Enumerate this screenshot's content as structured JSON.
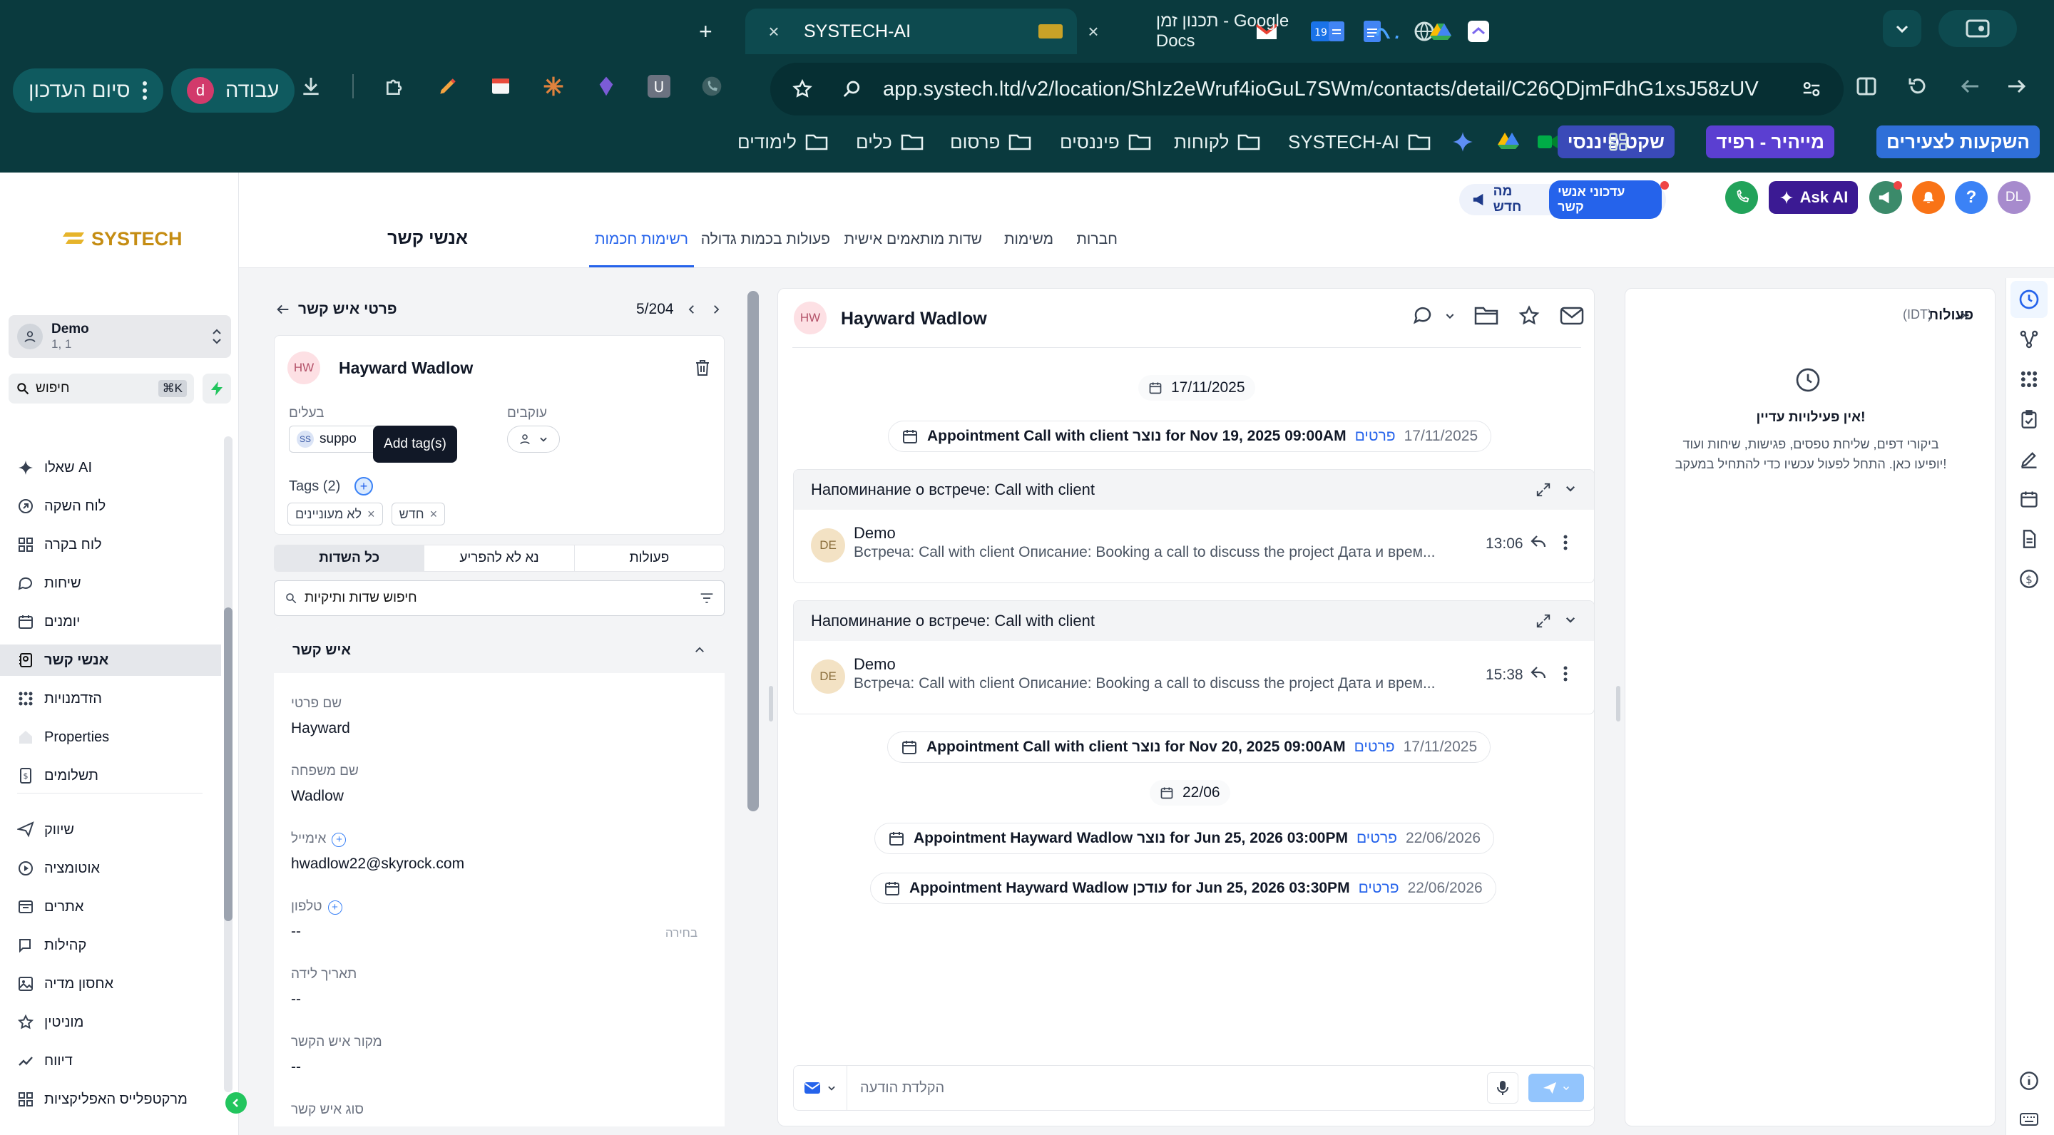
{
  "browser": {
    "tabs": [
      {
        "title": "SYSTECH-AI",
        "active": true
      },
      {
        "title": "תכנון זמן - Google Docs",
        "active": false
      }
    ],
    "url": "app.systech.ltd/v2/location/ShIz2eWruf4ioGuL7SWm/contacts/detail/C26QDjmFdhG1xsJ58zUV",
    "profile_pill": {
      "label": "עבודה",
      "avatar": "d"
    },
    "update_pill": "סיום העדכון",
    "bookmarks": [
      "SYSTECH-AI",
      "לקוחות",
      "פיננסים",
      "פרסום",
      "כלים",
      "לימודים"
    ],
    "bookmark_chips": [
      {
        "label": "השקעות לצעירים",
        "color": "#2f6fd8"
      },
      {
        "label": "מייהיר - רפיד",
        "color": "#5b3fd1"
      },
      {
        "label": "שקט פיננסי",
        "color": "#3a4ab8"
      }
    ]
  },
  "sidebar": {
    "logo": "SYSTECH",
    "account": {
      "name": "Demo",
      "sub": "1, 1"
    },
    "search": {
      "placeholder": "חיפוש",
      "shortcut": "⌘K"
    },
    "items": [
      {
        "label": "שאלו AI",
        "icon": "sparkle-icon"
      },
      {
        "label": "לוח השקה",
        "icon": "launch-icon"
      },
      {
        "label": "לוח בקרה",
        "icon": "dashboard-icon"
      },
      {
        "label": "שיחות",
        "icon": "chat-icon"
      },
      {
        "label": "יומנים",
        "icon": "calendar-icon"
      },
      {
        "label": "אנשי קשר",
        "icon": "contacts-icon",
        "active": true
      },
      {
        "label": "הזדמנויות",
        "icon": "opportunities-icon"
      },
      {
        "label": "Properties",
        "icon": "home-icon"
      },
      {
        "label": "תשלומים",
        "icon": "payments-icon"
      },
      {
        "label": "שיווק",
        "icon": "send-icon"
      },
      {
        "label": "אוטומציה",
        "icon": "automation-icon"
      },
      {
        "label": "אתרים",
        "icon": "sites-icon"
      },
      {
        "label": "קהילות",
        "icon": "communities-icon"
      },
      {
        "label": "אחסון מדיה",
        "icon": "media-icon"
      },
      {
        "label": "מוניטין",
        "icon": "star-icon"
      },
      {
        "label": "דיווח",
        "icon": "report-icon"
      },
      {
        "label": "מרקטפלייס האפליקציות",
        "icon": "marketplace-icon"
      }
    ]
  },
  "topbar": {
    "tabs": [
      "אנשי קשר",
      "רשימות חכמות",
      "פעולות בכמות גדולה",
      "שדות מותאמים אישית",
      "משימות",
      "חברות"
    ],
    "active_tab": "רשימות חכמות",
    "whats_new": "מה חדש",
    "contacts_update": "עדכוני אנשי קשר",
    "ask_ai": "Ask AI",
    "user_initials": "DL"
  },
  "contact_panel": {
    "title": "פרטי איש קשר",
    "pager": "5/204",
    "initials": "HW",
    "name": "Hayward Wadlow",
    "owner_label": "בעלים",
    "owner_value": "suppo",
    "owner_initials": "SS",
    "followers_label": "עוקבים",
    "tags_label": "Tags (2)",
    "tooltip": "Add tag(s)",
    "tags": [
      "לא מעוניינים",
      "חדש"
    ],
    "subtabs": [
      "כל השדות",
      "נא לא להפריע",
      "פעולות"
    ],
    "active_subtab": "כל השדות",
    "field_search_placeholder": "חיפוש שדות ותיקיות",
    "section_title": "איש קשר",
    "fields": [
      {
        "label": "שם פרטי",
        "value": "Hayward"
      },
      {
        "label": "שם משפחה",
        "value": "Wadlow"
      },
      {
        "label": "אימייל",
        "value": "hwadlow22@skyrock.com"
      },
      {
        "label": "טלפון",
        "value": "--",
        "hint": "בחירה"
      },
      {
        "label": "תאריך לידה",
        "value": "--"
      },
      {
        "label": "מקור איש הקשר",
        "value": "--"
      },
      {
        "label": "סוג איש קשר",
        "value": ""
      }
    ]
  },
  "conversation": {
    "initials": "HW",
    "name": "Hayward Wadlow",
    "date1": "17/11/2025",
    "event1": {
      "title": "Appointment Call with client נוצר for Nov 19, 2025 09:00AM",
      "link": "פרטים",
      "date": "17/11/2025"
    },
    "card1": {
      "header": "Напоминание о встрече: Call with client",
      "sender": "Demo",
      "initials": "DE",
      "snippet": "Встреча: Call with client Описание: Booking a call to discuss the project Дата и врем...",
      "time": "13:06"
    },
    "card2": {
      "header": "Напоминание о встрече: Call with client",
      "sender": "Demo",
      "initials": "DE",
      "snippet": "Встреча: Call with client Описание: Booking a call to discuss the project Дата и врем...",
      "time": "15:38"
    },
    "event2": {
      "title": "Appointment Call with client נוצר for Nov 20, 2025 09:00AM",
      "link": "פרטים",
      "date": "17/11/2025"
    },
    "date2": "22/06",
    "event3": {
      "title": "Appointment Hayward Wadlow נוצר for Jun 25, 2026 03:00PM",
      "link": "פרטים",
      "date": "22/06/2026"
    },
    "event4": {
      "title": "Appointment Hayward Wadlow עודכן for Jun 25, 2026 03:30PM",
      "link": "פרטים",
      "date": "22/06/2026"
    },
    "composer_placeholder": "הקלדת הודעה"
  },
  "activity": {
    "title": "פעולות",
    "sub": "(IDT)",
    "empty_title": "אין פעילויות עדיין!",
    "empty_line1": "ביקורי דפים, שליחת טפסים, פגישות, שיחות ועוד",
    "empty_line2": "יופיעו כאן. התחל לפעול עכשיו כדי להתחיל במעקב!"
  }
}
